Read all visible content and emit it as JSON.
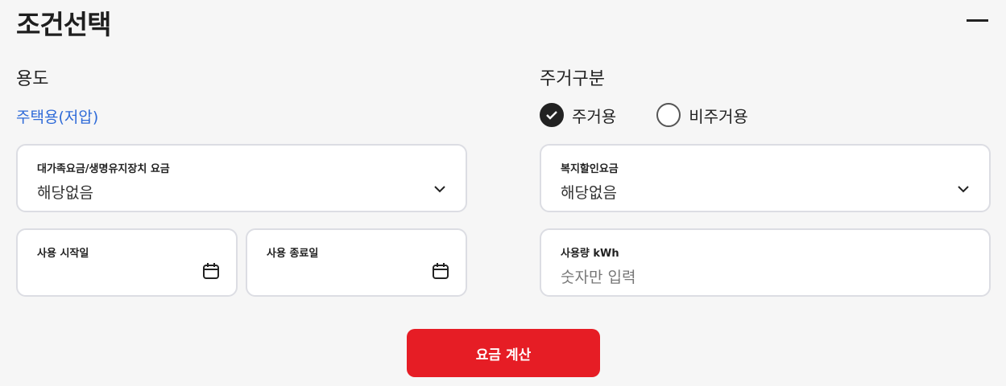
{
  "header": {
    "title": "조건선택",
    "collapse_icon": "minus-icon"
  },
  "usage": {
    "label": "용도",
    "value": "주택용(저압)",
    "value_color": "#2f6bd8"
  },
  "residence": {
    "label": "주거구분",
    "options": [
      {
        "label": "주거용",
        "checked": true
      },
      {
        "label": "비주거용",
        "checked": false
      }
    ]
  },
  "fields": {
    "large_family": {
      "label": "대가족요금/생명유지장치 요금",
      "value": "해당없음"
    },
    "welfare_discount": {
      "label": "복지할인요금",
      "value": "해당없음"
    },
    "start_date": {
      "label": "사용 시작일",
      "value": ""
    },
    "end_date": {
      "label": "사용 종료일",
      "value": ""
    },
    "usage_kwh": {
      "label": "사용량 kWh",
      "placeholder": "숫자만 입력"
    }
  },
  "actions": {
    "calculate_label": "요금 계산",
    "accent": "#e61d25"
  }
}
